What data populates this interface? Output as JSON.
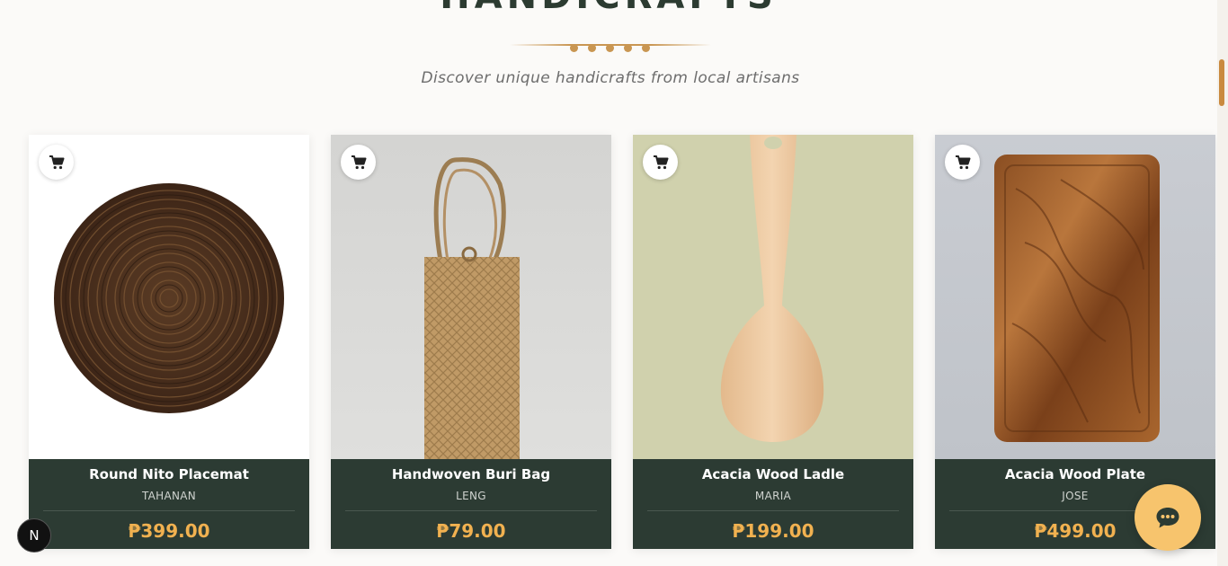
{
  "section": {
    "title": "HANDICRAFTS",
    "subtitle": "Discover unique handicrafts from local artisans"
  },
  "products": [
    {
      "name": "Round Nito Placemat",
      "maker": "TAHANAN",
      "price": "₱399.00",
      "image": "round-woven-placemat"
    },
    {
      "name": "Handwoven Buri Bag",
      "maker": "LENG",
      "price": "₱79.00",
      "image": "woven-buri-bag"
    },
    {
      "name": "Acacia Wood Ladle",
      "maker": "MARIA",
      "price": "₱199.00",
      "image": "wooden-ladle"
    },
    {
      "name": "Acacia Wood Plate",
      "maker": "JOSE",
      "price": "₱499.00",
      "image": "wooden-plate"
    }
  ],
  "icons": {
    "cart": "cart-icon",
    "chat": "chat-icon",
    "dev_badge": "N"
  },
  "colors": {
    "card_footer": "#2c3b33",
    "price": "#f1b150",
    "accent": "#c99652",
    "chat_button": "#f7c46d"
  }
}
